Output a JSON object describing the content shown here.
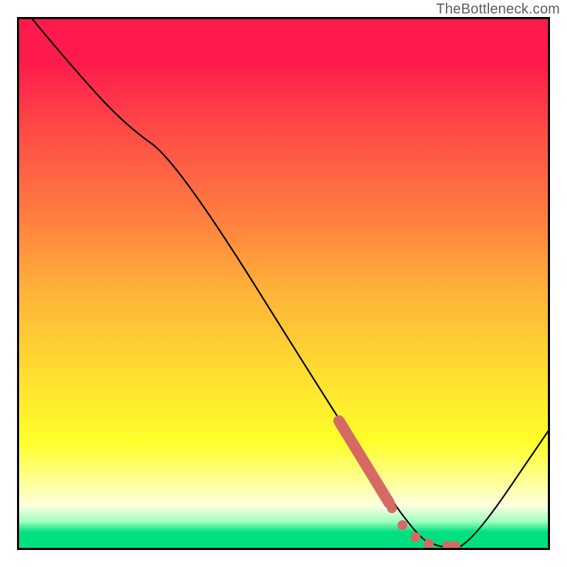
{
  "watermark": "TheBottleneck.com",
  "chart_data": {
    "type": "line",
    "title": "",
    "xlabel": "",
    "ylabel": "",
    "xlim": [
      0,
      100
    ],
    "ylim": [
      0,
      100
    ],
    "series": [
      {
        "name": "bottleneck-curve",
        "x": [
          0,
          10,
          20,
          30,
          60,
          75,
          80,
          85,
          100
        ],
        "y": [
          103,
          91,
          80,
          73,
          25,
          2,
          0,
          0,
          22
        ]
      }
    ],
    "highlight_segment": {
      "name": "highlight-thick",
      "x": [
        60.5,
        70
      ],
      "y": [
        24,
        8.5
      ]
    },
    "highlight_dots": {
      "name": "highlight-dots",
      "points": [
        {
          "x": 70.5,
          "y": 7.5
        },
        {
          "x": 72.5,
          "y": 4.3
        },
        {
          "x": 75,
          "y": 2.0
        },
        {
          "x": 77.5,
          "y": 0.8
        },
        {
          "x": 81,
          "y": 0.4
        },
        {
          "x": 82.5,
          "y": 0.4
        }
      ]
    },
    "gradient_stops": [
      {
        "pos": 0,
        "color": "#ff1a4d"
      },
      {
        "pos": 8,
        "color": "#ff1a4d"
      },
      {
        "pos": 20,
        "color": "#ff4747"
      },
      {
        "pos": 38,
        "color": "#ff8040"
      },
      {
        "pos": 52,
        "color": "#ffb438"
      },
      {
        "pos": 68,
        "color": "#ffe030"
      },
      {
        "pos": 80,
        "color": "#ffff2a"
      },
      {
        "pos": 88,
        "color": "#ffffa0"
      },
      {
        "pos": 92,
        "color": "#ffffe0"
      },
      {
        "pos": 95,
        "color": "#a0ffc0"
      },
      {
        "pos": 97,
        "color": "#00e080"
      },
      {
        "pos": 100,
        "color": "#00e080"
      }
    ]
  }
}
